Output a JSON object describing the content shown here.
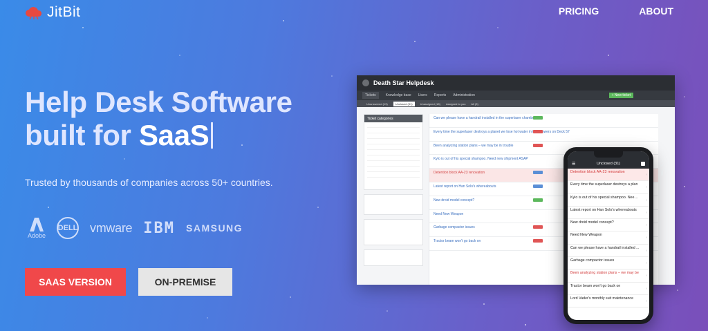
{
  "brand": {
    "name": "JitBit",
    "color": "#e8483f"
  },
  "nav": {
    "pricing": "PRICING",
    "about": "ABOUT"
  },
  "hero": {
    "title_line1": "Help Desk Software",
    "title_line2_prefix": "built for ",
    "title_line2_highlight": "SaaS",
    "subtitle": "Trusted by thousands of companies across 50+ countries."
  },
  "clients": {
    "adobe": "Adobe",
    "dell": "DELL",
    "vmware": "vmware",
    "ibm": "IBM",
    "samsung": "SAMSUNG"
  },
  "buttons": {
    "saas": "SAAS VERSION",
    "onprem": "ON-PREMISE",
    "saas_color": "#f0484a",
    "onprem_color": "#e6e6e6"
  },
  "mockup": {
    "title": "Death Star Helpdesk",
    "menu": [
      "Tickets",
      "Knowledge base",
      "Users",
      "Reports",
      "Administration"
    ],
    "new_ticket": "+ New ticket",
    "tabs": [
      "Unanswered (13)",
      "Unclosed (31)",
      "Unassigned (18)",
      "Assigned to you",
      "All (3)"
    ],
    "side_header": "Ticket categories",
    "tickets": [
      {
        "title": "Can we please have a handrail installed in the superlaser chamber?",
        "red": false,
        "hl": false
      },
      {
        "title": "Every time the superlaser destroys a planet we lose hot water in the showers on Deck 57",
        "red": false,
        "hl": false
      },
      {
        "title": "Been analyzing station plans – we may be in trouble",
        "red": false,
        "hl": false
      },
      {
        "title": "Kylo is out of his special shampoo. Need new shipment ASAP",
        "red": false,
        "hl": false
      },
      {
        "title": "Detention block AA-23 renovation",
        "red": true,
        "hl": true
      },
      {
        "title": "Latest report on Han Solo's whereabouts",
        "red": false,
        "hl": false
      },
      {
        "title": "New droid model concept?",
        "red": false,
        "hl": false
      },
      {
        "title": "Need New Weapon",
        "red": false,
        "hl": false
      },
      {
        "title": "Garbage compactor issues",
        "red": false,
        "hl": false
      },
      {
        "title": "Tractor beam won't go back on",
        "red": false,
        "hl": false
      }
    ]
  },
  "phone": {
    "header": "Unclosed (31)",
    "items": [
      {
        "title": "Detention block AA-23 renovation",
        "red": true,
        "hl": true
      },
      {
        "title": "Every time the superlaser destroys a plan",
        "red": false,
        "hl": false
      },
      {
        "title": "Kylo is out of his special shampoo. Need ne",
        "red": false,
        "hl": false
      },
      {
        "title": "Latest report on Han Solo's whereabouts",
        "red": false,
        "hl": false
      },
      {
        "title": "New droid model concept?",
        "red": false,
        "hl": false
      },
      {
        "title": "Need New Weapon",
        "red": false,
        "hl": false
      },
      {
        "title": "Can we please have a handrail installed ...",
        "red": false,
        "hl": false
      },
      {
        "title": "Garbage compactor issues",
        "red": false,
        "hl": false
      },
      {
        "title": "Been analyzing station plans – we may be",
        "red": true,
        "hl": false
      },
      {
        "title": "Tractor beam won't go back on",
        "red": false,
        "hl": false
      },
      {
        "title": "Lord Vader's monthly suit maintenance",
        "red": false,
        "hl": false
      }
    ]
  }
}
